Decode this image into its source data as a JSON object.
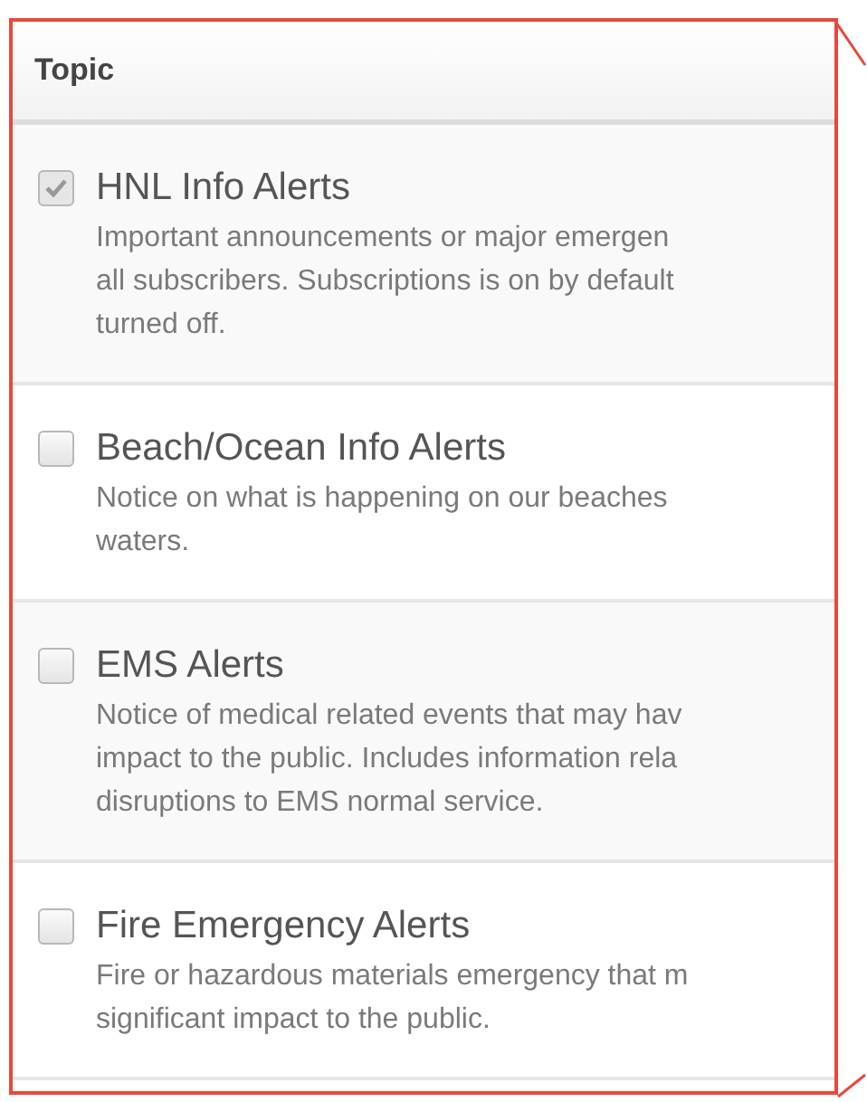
{
  "table": {
    "columns": [
      "Topic"
    ],
    "rows": [
      {
        "title": "HNL Info Alerts",
        "checked": true,
        "disabled": true,
        "description": [
          "Important announcements or major emergen",
          "all subscribers. Subscriptions is on by default",
          "turned off."
        ]
      },
      {
        "title": "Beach/Ocean Info Alerts",
        "checked": false,
        "disabled": false,
        "description": [
          "Notice on what is happening on our beaches",
          "waters."
        ]
      },
      {
        "title": "EMS Alerts",
        "checked": false,
        "disabled": false,
        "description": [
          "Notice of medical related events that may hav",
          "impact to the public. Includes information rela",
          "disruptions to EMS normal service."
        ]
      },
      {
        "title": "Fire Emergency Alerts",
        "checked": false,
        "disabled": false,
        "description": [
          "Fire or hazardous materials emergency that m",
          "significant impact to the public."
        ]
      }
    ]
  }
}
